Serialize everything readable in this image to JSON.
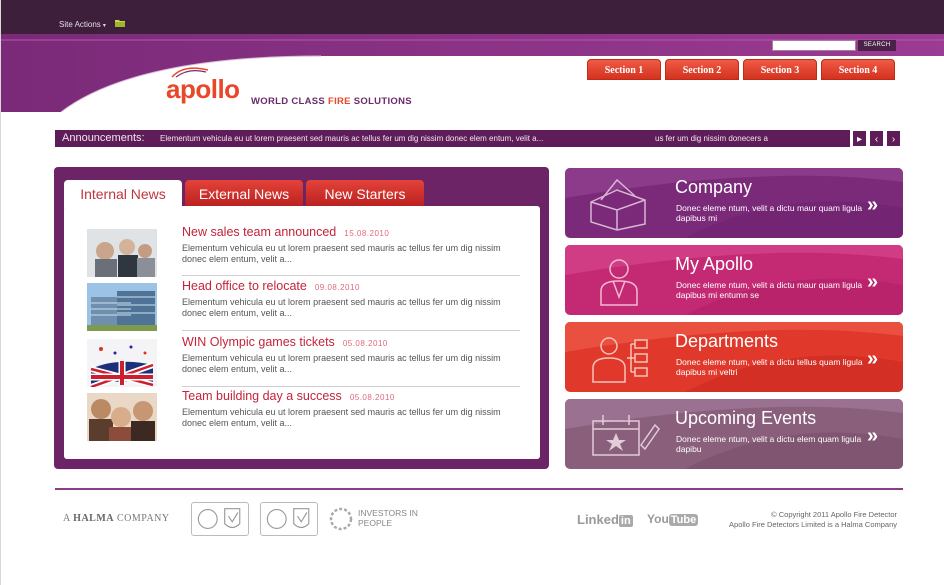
{
  "topbar": {
    "site_actions": "Site Actions",
    "caret": "▾"
  },
  "search": {
    "placeholder": "",
    "button": "SEARCH"
  },
  "sections": [
    "Section 1",
    "Section 2",
    "Section 3",
    "Section 4"
  ],
  "brand": {
    "logo": "apollo",
    "tagline_pre": "WORLD CLASS ",
    "tagline_hl": "FIRE",
    "tagline_post": " SOLUTIONS"
  },
  "announcements": {
    "label": "Announcements:",
    "text1": "Elementum vehicula eu ut lorem praesent sed mauris ac tellus fer um dig nissim donec elem entum, velit a...",
    "text2": "us fer um dig nissim donecers a",
    "buttons": [
      "▸",
      "‹",
      "›"
    ]
  },
  "news": {
    "tabs": [
      "Internal News",
      "External News",
      "New Starters"
    ],
    "items": [
      {
        "title": "New sales team announced",
        "date": "15.08.2010",
        "body": "Elementum vehicula eu ut lorem praesent sed mauris ac tellus fer um dig nissim donec elem entum, velit a..."
      },
      {
        "title": "Head office to relocate",
        "date": "09.08.2010",
        "body": "Elementum vehicula eu ut lorem praesent sed mauris ac tellus fer um dig nissim donec elem entum, velit a..."
      },
      {
        "title": "WIN Olympic games tickets",
        "date": "05.08.2010",
        "body": "Elementum vehicula eu ut lorem praesent sed mauris ac tellus fer um dig nissim donec elem entum, velit a..."
      },
      {
        "title": "Team building day a success",
        "date": "05.08.2010",
        "body": "Elementum vehicula eu ut lorem praesent sed mauris ac tellus fer um dig nissim donec elem entum, velit a..."
      }
    ]
  },
  "tiles": [
    {
      "title": "Company",
      "desc": "Donec eleme ntum, velit a dictu maur quam ligula dapibus mi",
      "color": "#7a2a78",
      "icon": "building-icon"
    },
    {
      "title": "My Apollo",
      "desc": "Donec eleme ntum, velit a dictu maur quam ligula dapibus mi entumn se",
      "color": "#c42a74",
      "icon": "person-icon"
    },
    {
      "title": "Departments",
      "desc": "Donec eleme ntum, velit a dictu tellus quam ligula dapibus mi veltri",
      "color": "#e0392c",
      "icon": "org-chart-icon"
    },
    {
      "title": "Upcoming Events",
      "desc": "Donec eleme ntum, velit a dictu elem quam ligula dapibu",
      "color": "#8a5f7c",
      "icon": "calendar-star-icon"
    }
  ],
  "tile_arrow": "»",
  "footer": {
    "halma_pre": "A ",
    "halma_bold": "HALMA",
    "halma_post": " COMPANY",
    "investors": "INVESTORS IN PEOPLE",
    "linkedin": "Linked",
    "linkedin_in": "in",
    "youtube_you": "You",
    "youtube_tube": "Tube",
    "copyright1": "© Copyright 2011 Apollo Fire Detector",
    "copyright2": "Apollo Fire Detectors Limited is a Halma Company"
  }
}
